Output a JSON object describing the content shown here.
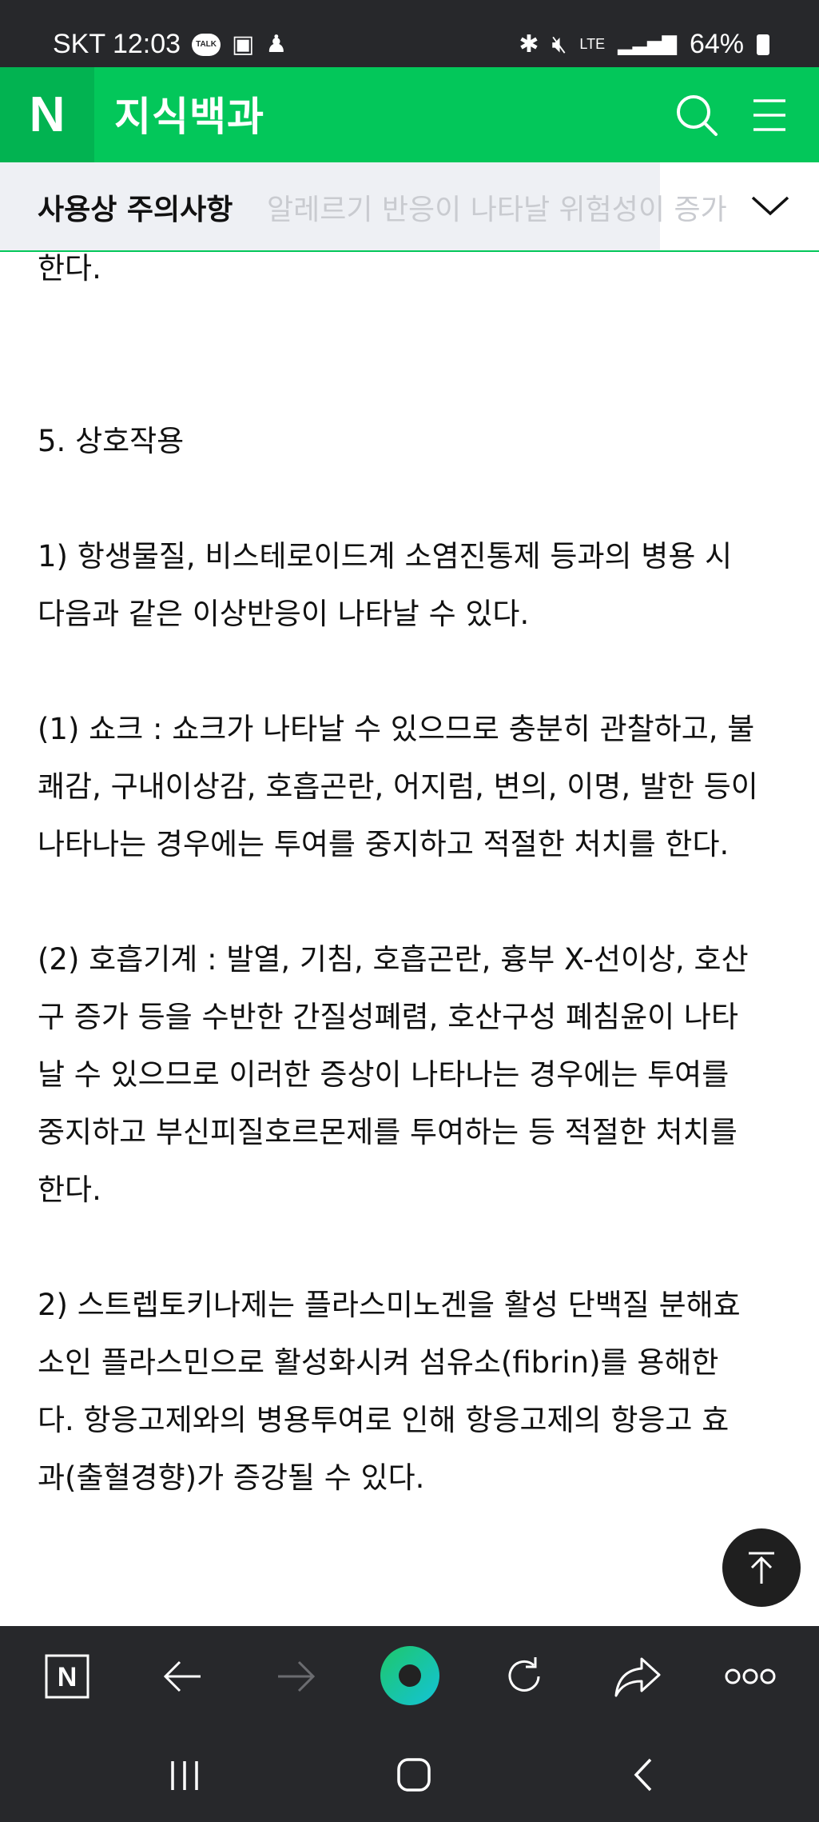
{
  "status_bar": {
    "carrier_time": "SKT 12:03",
    "talk_badge": "TALK",
    "network": "LTE",
    "battery": "64%"
  },
  "header": {
    "logo": "N",
    "title": "지식백과"
  },
  "section_bar": {
    "title": "사용상 주의사항",
    "ghost_text": "알레르기 반응이 나타날 위험성이 증가"
  },
  "content": {
    "fragment": "한다.",
    "heading": "5. 상호작용",
    "p1": "1) 항생물질, 비스테로이드계 소염진통제 등과의 병용 시\n다음과 같은 이상반응이 나타날 수 있다.",
    "p2": "(1) 쇼크 : 쇼크가 나타날 수 있으므로 충분히 관찰하고, 불\n쾌감, 구내이상감, 호흡곤란, 어지럼, 변의, 이명, 발한 등이\n나타나는 경우에는 투여를 중지하고 적절한 처치를 한다.",
    "p3": "(2) 호흡기계 : 발열, 기침, 호흡곤란, 흉부 X-선이상, 호산\n구 증가 등을 수반한 간질성폐렴, 호산구성 폐침윤이 나타\n날 수 있으므로 이러한 증상이 나타나는 경우에는 투여를\n중지하고 부신피질호르몬제를 투여하는 등 적절한 처치를\n한다.",
    "p4": "2) 스트렙토키나제는 플라스미노겐을 활성 단백질 분해효\n소인 플라스민으로 활성화시켜 섬유소(fibrin)를 용해한\n다. 항응고제와의 병용투여로 인해 항응고제의 항응고 효\n과(출혈경향)가 증강될 수 있다."
  },
  "colors": {
    "brand_green": "#03c75a",
    "system_bar": "#27282b",
    "reload_center": "#1bc47d"
  },
  "icons": [
    "chat-icon",
    "gallery-icon",
    "notification-icon",
    "bluetooth-icon",
    "mute-icon",
    "signal-icon",
    "battery-icon",
    "search-icon",
    "menu-icon",
    "chevron-down-icon",
    "arrow-up-icon",
    "naver-home-icon",
    "back-arrow-icon",
    "forward-arrow-icon",
    "green-dot-icon",
    "reload-icon",
    "share-icon",
    "more-icon",
    "recents-icon",
    "home-icon",
    "back-icon"
  ]
}
